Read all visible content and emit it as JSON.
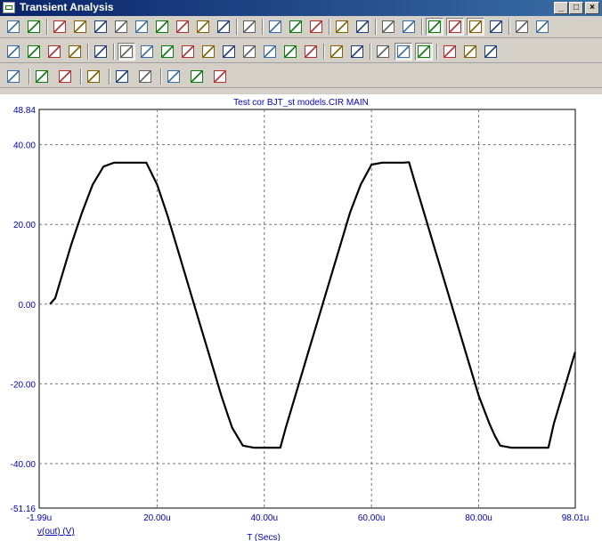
{
  "window": {
    "title": "Transient Analysis"
  },
  "window_buttons": {
    "minimize": "_",
    "maximize": "□",
    "close": "×"
  },
  "chart_data": {
    "type": "line",
    "title": "Test cor BJT_st models.CIR MAIN",
    "xlabel": "T (Secs)",
    "ylabel": "",
    "trace_label": "v(out) (V)",
    "xlim_label": [
      "-1.99u",
      "98.01u"
    ],
    "ylim": [
      -51.16,
      48.84
    ],
    "x_ticks": [
      "-1.99u",
      "20.00u",
      "40.00u",
      "60.00u",
      "80.00u",
      "98.01u"
    ],
    "x_tick_values": [
      -1.99,
      20,
      40,
      60,
      80,
      98.01
    ],
    "y_ticks": [
      "48.84",
      "40.00",
      "20.00",
      "0.00",
      "-20.00",
      "-40.00",
      "-51.16"
    ],
    "y_tick_values": [
      48.84,
      40,
      20,
      0,
      -20,
      -40,
      -51.16
    ],
    "grid": true,
    "series": [
      {
        "name": "v(out)",
        "color": "#000000",
        "x": [
          0,
          1,
          2,
          4,
          6,
          8,
          10,
          12,
          14,
          16,
          18,
          20,
          22,
          24,
          26,
          28,
          30,
          32,
          33,
          34,
          36,
          38,
          40,
          42,
          43,
          44,
          46,
          48,
          50,
          52,
          54,
          56,
          58,
          60,
          62,
          64,
          66,
          67,
          68,
          70,
          72,
          74,
          76,
          78,
          80,
          82,
          83,
          84,
          86,
          88,
          90,
          92,
          93,
          94,
          96,
          98
        ],
        "y": [
          0,
          1.5,
          6,
          15,
          23,
          30,
          34.5,
          35.5,
          35.5,
          35.5,
          35.5,
          30,
          22,
          13,
          4,
          -5,
          -14,
          -23,
          -27,
          -31,
          -35.5,
          -36,
          -36,
          -36,
          -36,
          -31,
          -22,
          -13,
          -4,
          5,
          14,
          23,
          30,
          35,
          35.5,
          35.5,
          35.5,
          35.6,
          31,
          22,
          13,
          4,
          -5,
          -14,
          -23,
          -30,
          -33,
          -35.5,
          -36,
          -36,
          -36,
          -36,
          -36,
          -30,
          -21,
          -12
        ]
      }
    ]
  },
  "toolbar": {
    "row1": [
      "select-arrow-icon",
      "hand-pan-icon",
      "copy-icon",
      "image-icon",
      "scale-icon",
      "tag-icon",
      "tag2-icon",
      "tag3-icon",
      "tag4-icon",
      "fx-icon",
      "text-icon",
      "properties-icon",
      "run-icon",
      "stop-icon",
      "pause-icon",
      "graph-a-icon",
      "graph-b-icon",
      "window-a-icon",
      "window-b-icon",
      "layout1-icon",
      "layout2-icon",
      "layout3-icon",
      "layout4-icon",
      "layout5-icon",
      "layout6-icon"
    ],
    "row2": [
      "zoom-auto-icon",
      "zoom-fit-icon",
      "zoom-x-icon",
      "zoom-y-icon",
      "props2-icon",
      "cursor1-icon",
      "cursor2-icon",
      "peak-icon",
      "valley-icon",
      "high-icon",
      "low-icon",
      "inflect-icon",
      "slope-icon",
      "diff-icon",
      "next-icon",
      "clipboard-icon",
      "list-icon",
      "number-icon",
      "autoscale-icon",
      "fit-icon",
      "zoom-in-icon",
      "zoom-out-icon",
      "zoom-100-icon"
    ],
    "row3": [
      "grid-icon",
      "font-icon",
      "font-size-icon",
      "prev-icon",
      "align-left-icon",
      "align-right-icon",
      "align-center-icon",
      "align-top-icon",
      "align-bottom-icon"
    ]
  }
}
